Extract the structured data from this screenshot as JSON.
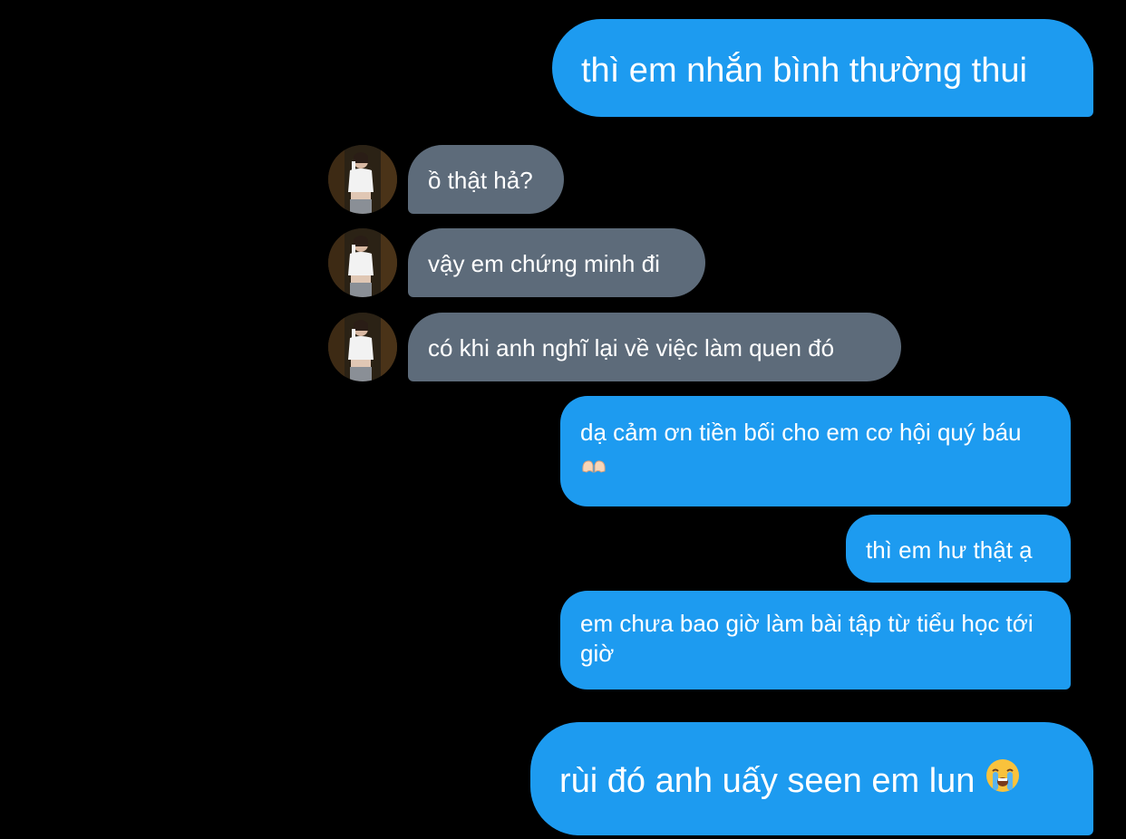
{
  "messages": [
    {
      "direction": "sent",
      "text": "thì em nhắn bình thường thui"
    },
    {
      "direction": "received",
      "text": "ồ thật hả?",
      "avatar_icon": "contact-avatar"
    },
    {
      "direction": "received",
      "text": "vậy em chứng minh đi",
      "avatar_icon": "contact-avatar"
    },
    {
      "direction": "received",
      "text": "có khi anh nghĩ lại về việc làm quen đó",
      "avatar_icon": "contact-avatar"
    },
    {
      "direction": "sent",
      "text": "dạ cảm ơn tiền bối cho em cơ hội quý báu",
      "emoji": "heart-hands-icon"
    },
    {
      "direction": "sent",
      "text": "thì em hư thật ạ"
    },
    {
      "direction": "sent",
      "text": "em chưa bao giờ làm bài tập từ tiểu học tới giờ"
    },
    {
      "direction": "sent",
      "text": "rùi đó anh uấy seen em lun",
      "emoji": "loudly-crying-face-icon"
    }
  ],
  "colors": {
    "background": "#000000",
    "sent_bubble": "#1d9bf0",
    "received_bubble": "#5d6b7a",
    "text": "#ffffff"
  }
}
